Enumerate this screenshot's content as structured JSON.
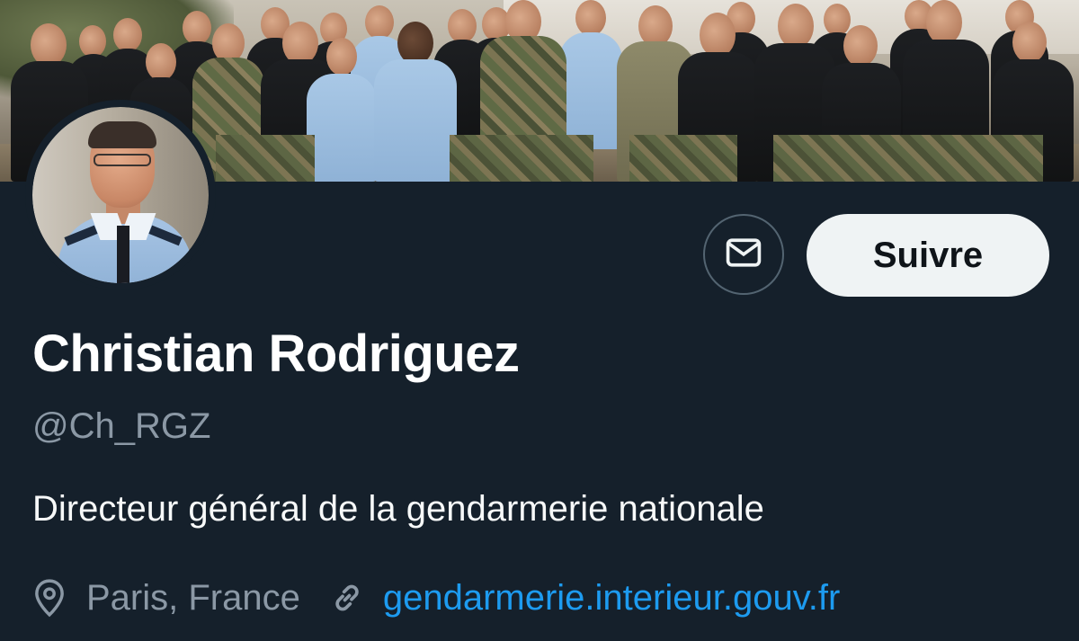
{
  "profile": {
    "display_name": "Christian Rodriguez",
    "handle": "@Ch_RGZ",
    "bio": "Directeur général de la gendarmerie nationale",
    "location": "Paris, France",
    "website": "gendarmerie.interieur.gouv.fr"
  },
  "actions": {
    "follow_label": "Suivre",
    "message_icon": "envelope-icon"
  },
  "icons": {
    "location": "location-pin-icon",
    "link": "link-icon"
  },
  "colors": {
    "background": "#15202b",
    "primary_text": "#ffffff",
    "secondary_text": "#8b98a5",
    "link": "#1d9bf0",
    "follow_button_bg": "#eff3f4",
    "follow_button_text": "#0f1419",
    "outline": "#536471"
  }
}
